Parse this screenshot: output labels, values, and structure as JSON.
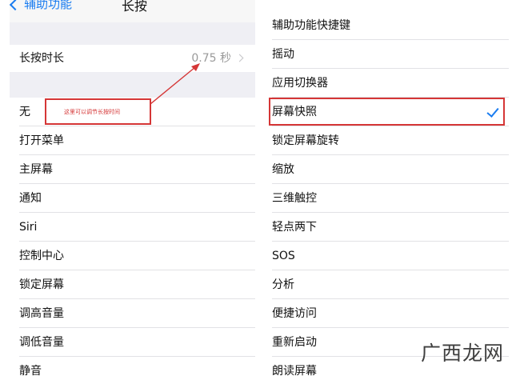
{
  "left": {
    "nav_back_label": "辅助功能",
    "nav_title": "长按",
    "duration_row": {
      "label": "长按时长",
      "value": "0.75 秒"
    },
    "items": [
      "无",
      "打开菜单",
      "主屏幕",
      "通知",
      "Siri",
      "控制中心",
      "锁定屏幕",
      "调高音量",
      "调低音量",
      "静音"
    ]
  },
  "right": {
    "items": [
      "辅助功能快捷键",
      "摇动",
      "应用切换器",
      "屏幕快照",
      "锁定屏幕旋转",
      "缩放",
      "三维触控",
      "轻点两下",
      "SOS",
      "分析",
      "便捷访问",
      "重新启动",
      "朗读屏幕"
    ],
    "selected_item": "屏幕快照"
  },
  "annotation": {
    "text": "这里可以调节长按时间"
  },
  "watermark": {
    "text": "广西龙网"
  },
  "colors": {
    "accent": "#1a7cf0",
    "annotation_red": "#d53636",
    "group_bg": "#efeff4"
  }
}
